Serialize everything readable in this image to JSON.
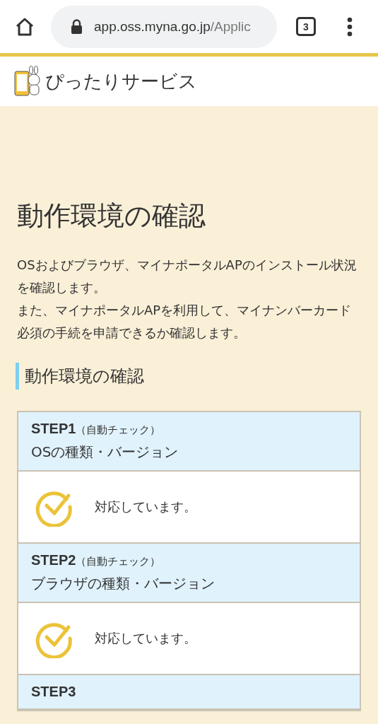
{
  "browser": {
    "url_host": "app.oss.myna.go.jp",
    "url_path": "/Applic",
    "tab_count": "3"
  },
  "site": {
    "name": "ぴったりサービス"
  },
  "page": {
    "title": "動作環境の確認",
    "intro": [
      "OSおよびブラウザ、マイナポータルAPのインストール状況を確認します。",
      "また、マイナポータルAPを利用して、マイナンバーカード必須の手続を申請できるか確認します。"
    ]
  },
  "section": {
    "heading": "動作環境の確認"
  },
  "steps": [
    {
      "step": "STEP1",
      "note": "（自動チェック）",
      "title": "OSの種類・バージョン",
      "result": "対応しています。",
      "ok": true
    },
    {
      "step": "STEP2",
      "note": "（自動チェック）",
      "title": "ブラウザの種類・バージョン",
      "result": "対応しています。",
      "ok": true
    },
    {
      "step": "STEP3"
    }
  ]
}
